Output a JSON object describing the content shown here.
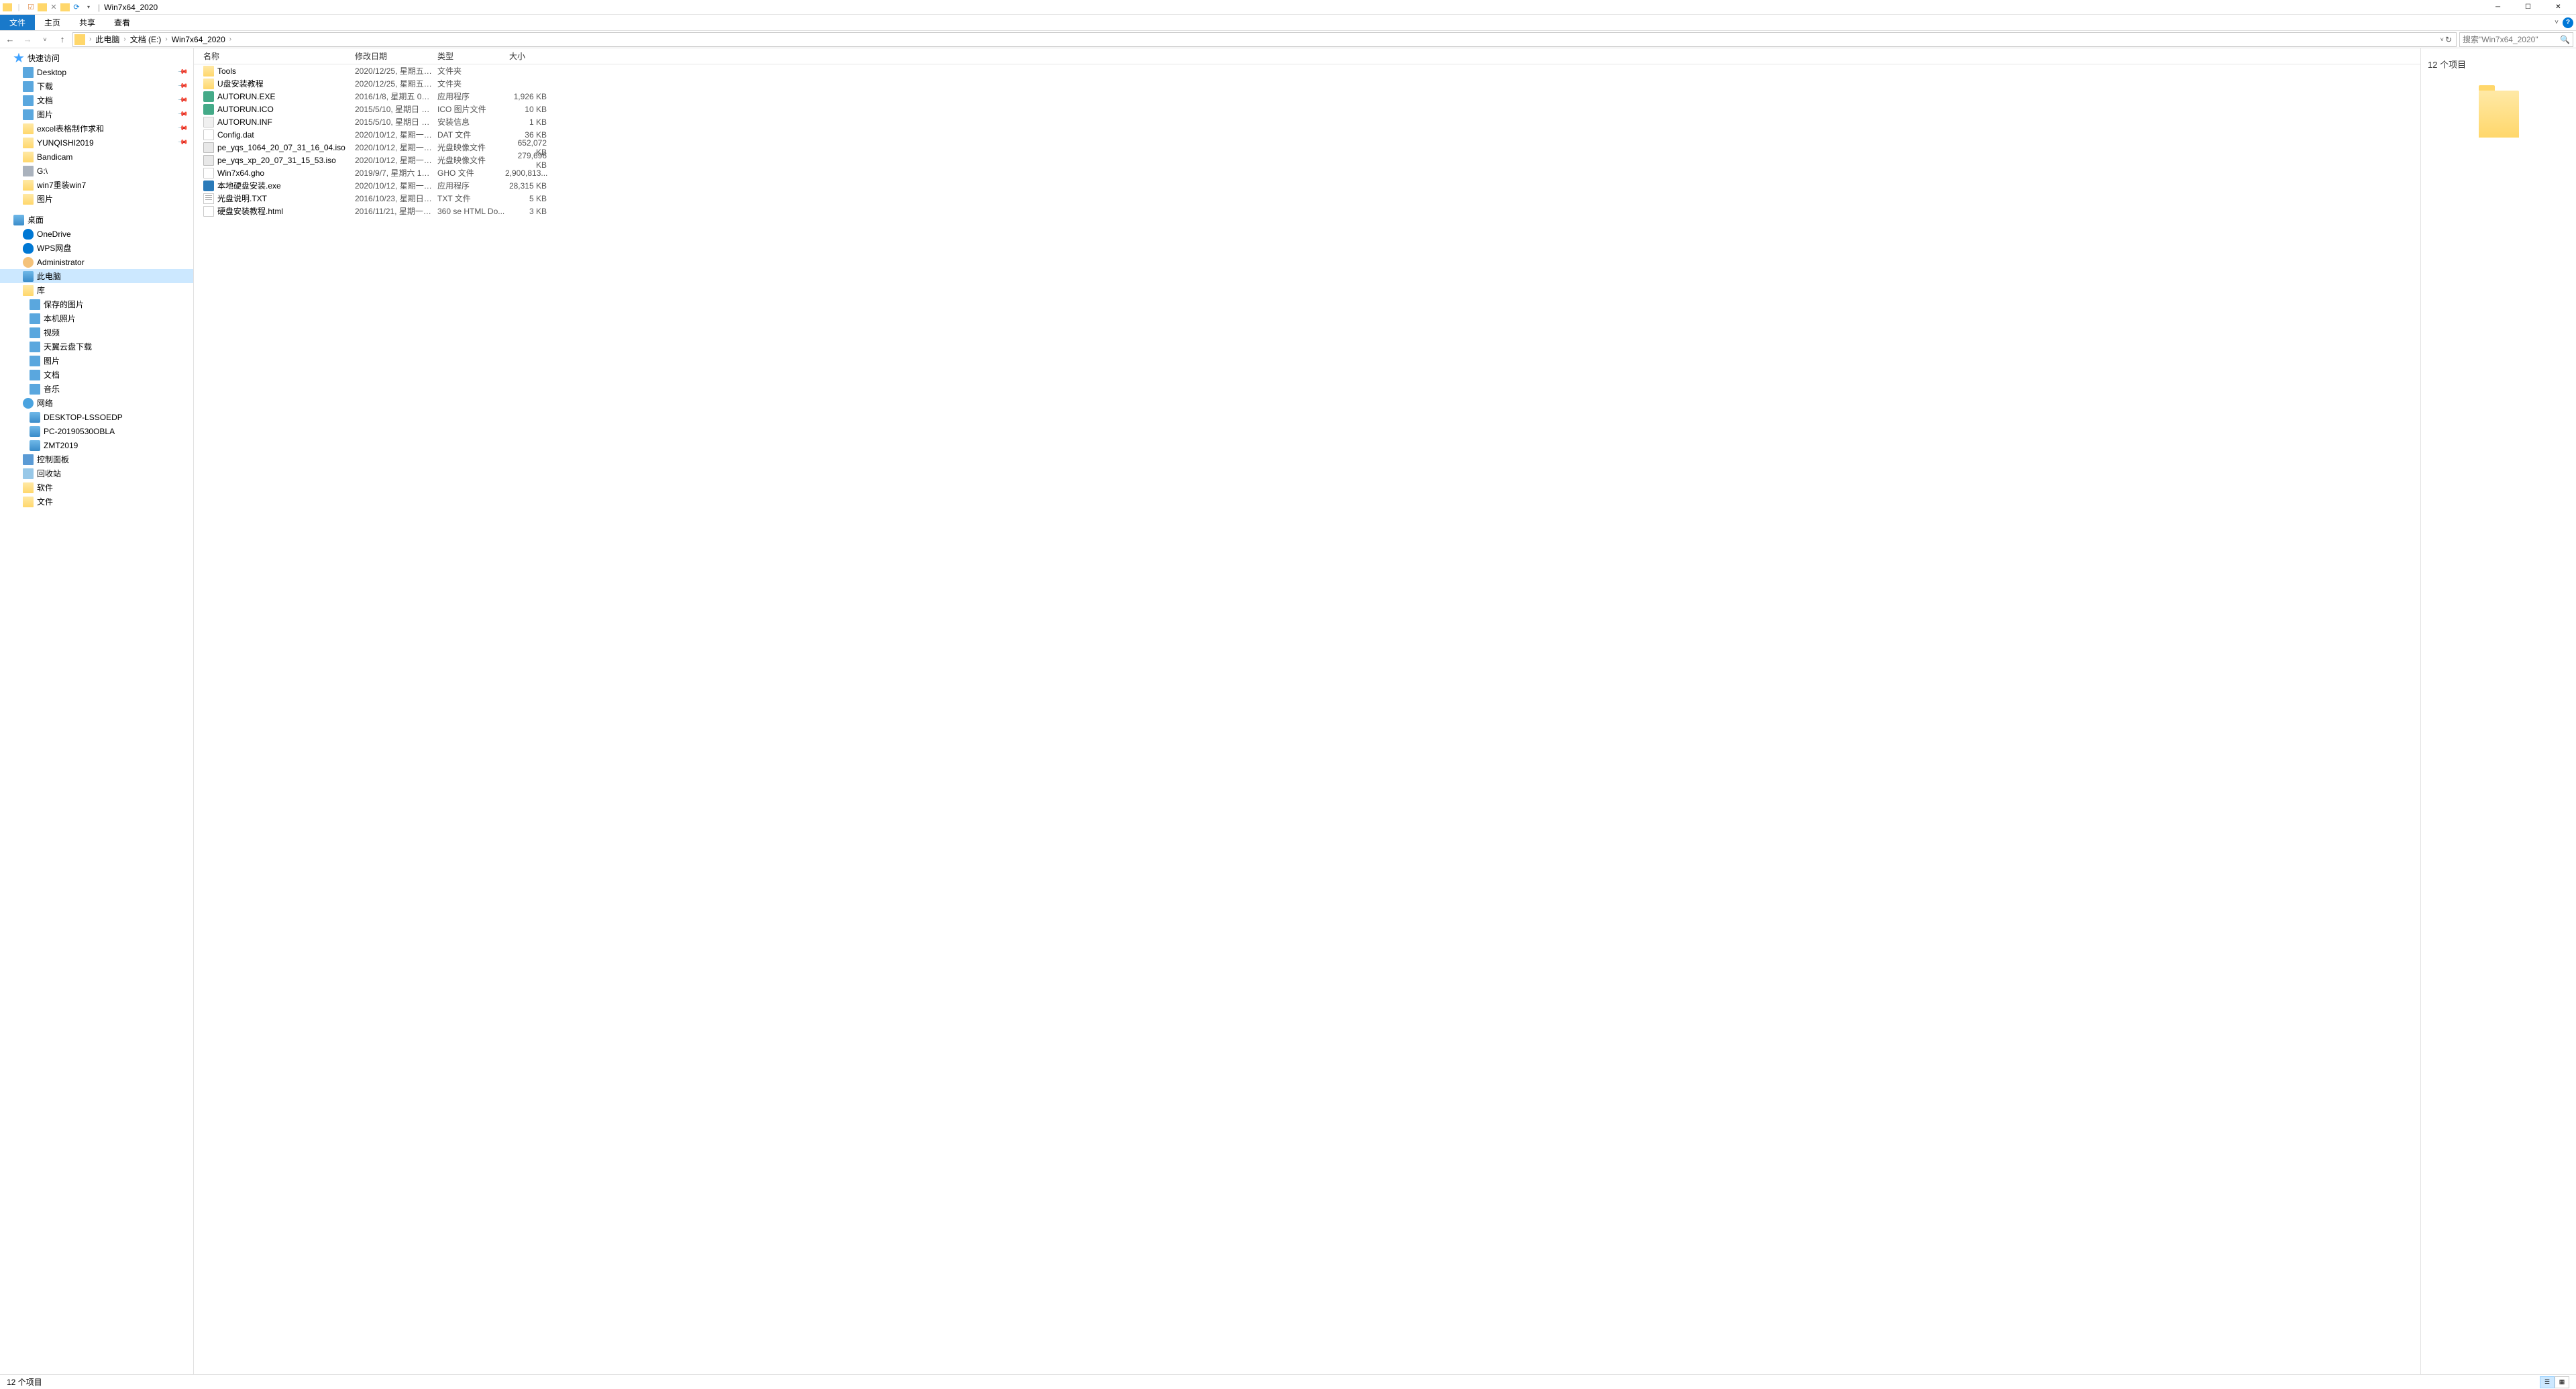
{
  "title": "Win7x64_2020",
  "ribbon": {
    "file": "文件",
    "tabs": [
      "主页",
      "共享",
      "查看"
    ]
  },
  "breadcrumb": [
    "此电脑",
    "文档 (E:)",
    "Win7x64_2020"
  ],
  "search_placeholder": "搜索\"Win7x64_2020\"",
  "columns": {
    "name": "名称",
    "date": "修改日期",
    "type": "类型",
    "size": "大小"
  },
  "tree": {
    "quick": "快速访问",
    "quick_items": [
      {
        "label": "Desktop",
        "icon": "ic-folder-blue",
        "pin": true
      },
      {
        "label": "下载",
        "icon": "ic-folder-blue",
        "pin": true
      },
      {
        "label": "文档",
        "icon": "ic-folder-blue",
        "pin": true
      },
      {
        "label": "图片",
        "icon": "ic-folder-blue",
        "pin": true
      },
      {
        "label": "excel表格制作求和",
        "icon": "ic-folder",
        "pin": true
      },
      {
        "label": "YUNQISHI2019",
        "icon": "ic-folder",
        "pin": true
      },
      {
        "label": "Bandicam",
        "icon": "ic-folder",
        "pin": false
      },
      {
        "label": "G:\\",
        "icon": "ic-disk",
        "pin": false
      },
      {
        "label": "win7重装win7",
        "icon": "ic-folder",
        "pin": false
      },
      {
        "label": "图片",
        "icon": "ic-folder",
        "pin": false
      }
    ],
    "desktop": "桌面",
    "desktop_items": [
      {
        "label": "OneDrive",
        "icon": "ic-cloud"
      },
      {
        "label": "WPS网盘",
        "icon": "ic-cloud"
      },
      {
        "label": "Administrator",
        "icon": "ic-user"
      },
      {
        "label": "此电脑",
        "icon": "ic-monitor",
        "selected": true
      },
      {
        "label": "库",
        "icon": "ic-folder"
      }
    ],
    "lib_items": [
      {
        "label": "保存的图片",
        "icon": "ic-folder-blue"
      },
      {
        "label": "本机照片",
        "icon": "ic-folder-blue"
      },
      {
        "label": "视频",
        "icon": "ic-folder-blue"
      },
      {
        "label": "天翼云盘下载",
        "icon": "ic-folder-blue"
      },
      {
        "label": "图片",
        "icon": "ic-folder-blue"
      },
      {
        "label": "文档",
        "icon": "ic-folder-blue"
      },
      {
        "label": "音乐",
        "icon": "ic-folder-blue"
      }
    ],
    "network": "网络",
    "net_items": [
      {
        "label": "DESKTOP-LSSOEDP",
        "icon": "ic-monitor"
      },
      {
        "label": "PC-20190530OBLA",
        "icon": "ic-monitor"
      },
      {
        "label": "ZMT2019",
        "icon": "ic-monitor"
      }
    ],
    "control": "控制面板",
    "recycle": "回收站",
    "soft": "软件",
    "files_f": "文件"
  },
  "files": [
    {
      "name": "Tools",
      "date": "2020/12/25, 星期五 1...",
      "type": "文件夹",
      "size": "",
      "icon": "fi-folder"
    },
    {
      "name": "U盘安装教程",
      "date": "2020/12/25, 星期五 1...",
      "type": "文件夹",
      "size": "",
      "icon": "fi-folder"
    },
    {
      "name": "AUTORUN.EXE",
      "date": "2016/1/8, 星期五 04:...",
      "type": "应用程序",
      "size": "1,926 KB",
      "icon": "fi-exe"
    },
    {
      "name": "AUTORUN.ICO",
      "date": "2015/5/10, 星期日 02...",
      "type": "ICO 图片文件",
      "size": "10 KB",
      "icon": "fi-ico"
    },
    {
      "name": "AUTORUN.INF",
      "date": "2015/5/10, 星期日 02...",
      "type": "安装信息",
      "size": "1 KB",
      "icon": "fi-inf"
    },
    {
      "name": "Config.dat",
      "date": "2020/10/12, 星期一 1...",
      "type": "DAT 文件",
      "size": "36 KB",
      "icon": "fi-dat"
    },
    {
      "name": "pe_yqs_1064_20_07_31_16_04.iso",
      "date": "2020/10/12, 星期一 1...",
      "type": "光盘映像文件",
      "size": "652,072 KB",
      "icon": "fi-iso"
    },
    {
      "name": "pe_yqs_xp_20_07_31_15_53.iso",
      "date": "2020/10/12, 星期一 1...",
      "type": "光盘映像文件",
      "size": "279,696 KB",
      "icon": "fi-iso"
    },
    {
      "name": "Win7x64.gho",
      "date": "2019/9/7, 星期六 19:...",
      "type": "GHO 文件",
      "size": "2,900,813...",
      "icon": "fi-gho"
    },
    {
      "name": "本地硬盘安装.exe",
      "date": "2020/10/12, 星期一 1...",
      "type": "应用程序",
      "size": "28,315 KB",
      "icon": "fi-exe2"
    },
    {
      "name": "光盘说明.TXT",
      "date": "2016/10/23, 星期日 0...",
      "type": "TXT 文件",
      "size": "5 KB",
      "icon": "fi-txt"
    },
    {
      "name": "硬盘安装教程.html",
      "date": "2016/11/21, 星期一 2...",
      "type": "360 se HTML Do...",
      "size": "3 KB",
      "icon": "fi-html"
    }
  ],
  "preview": {
    "title": "12 个项目"
  },
  "status": {
    "text": "12 个项目"
  }
}
